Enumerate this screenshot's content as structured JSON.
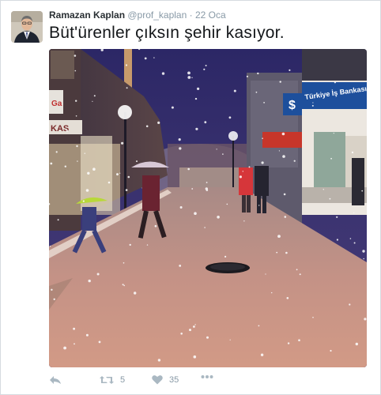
{
  "tweet": {
    "author_name": "Ramazan Kaplan",
    "handle": "@prof_kaplan",
    "separator": "·",
    "date": "22 Oca",
    "text": "Büt'ürenler çıksın şehir kasıyor."
  },
  "media": {
    "bank_sign": "Türkiye İş Bankası",
    "bank_symbol": "$",
    "shop_sign_left": "Ga",
    "shop_sign_left2": "KAS"
  },
  "actions": {
    "reply_icon": "reply-icon",
    "retweet_icon": "retweet-icon",
    "retweet_count": "5",
    "like_icon": "heart-icon",
    "like_count": "35",
    "more_icon": "more-icon"
  },
  "colors": {
    "name": "#292f33",
    "muted": "#8899a6",
    "icon": "#aab8c2",
    "bank_blue": "#1d4f9c"
  }
}
